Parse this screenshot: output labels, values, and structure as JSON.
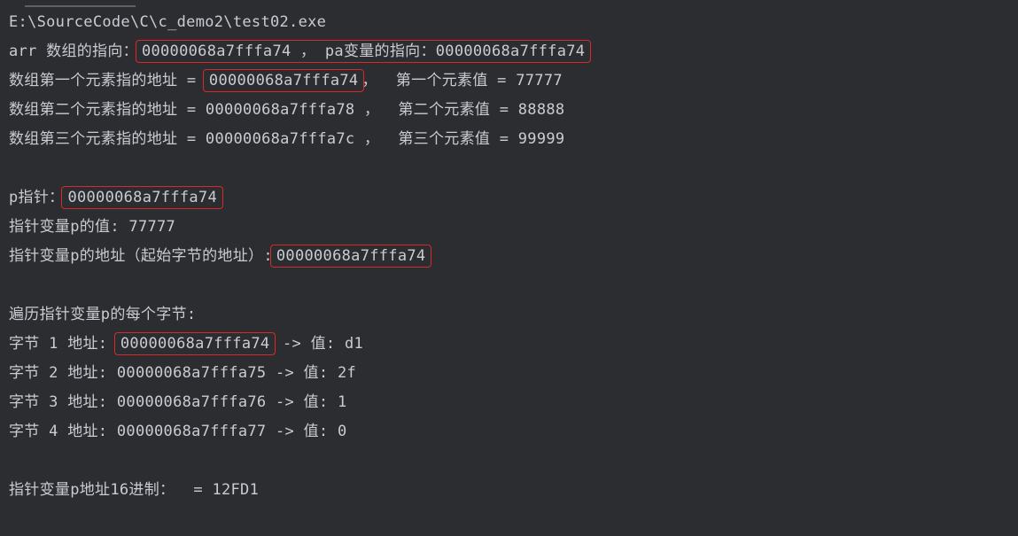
{
  "colors": {
    "background": "#2b2d30",
    "text": "#c9ccd3",
    "highlight_box": "#d8282b"
  },
  "console": {
    "path": "E:\\SourceCode\\C\\c_demo2\\test02.exe",
    "l1_prefix": "arr 数组的指向：",
    "l1_highlight": "00000068a7fffa74 ， pa变量的指向：00000068a7fffa74",
    "l2_prefix": "数组第一个元素指的地址 = ",
    "l2_highlight": "00000068a7fffa74",
    "l2_suffix": "，  第一个元素值 = 77777",
    "l3": "数组第二个元素指的地址 = 00000068a7fffa78 ，  第二个元素值 = 88888",
    "l4": "数组第三个元素指的地址 = 00000068a7fffa7c ，  第三个元素值 = 99999",
    "l5_prefix": "p指针：",
    "l5_highlight": "00000068a7fffa74",
    "l6": "指针变量p的值: 77777",
    "l7_prefix": "指针变量p的地址（起始字节的地址）:",
    "l7_highlight": "00000068a7fffa74",
    "l8": "遍历指针变量p的每个字节:",
    "l9_prefix": "字节 1 地址: ",
    "l9_highlight": "00000068a7fffa74",
    "l9_suffix": " -> 值: d1",
    "l10": "字节 2 地址: 00000068a7fffa75 -> 值: 2f",
    "l11": "字节 3 地址: 00000068a7fffa76 -> 值: 1",
    "l12": "字节 4 地址: 00000068a7fffa77 -> 值: 0",
    "l13": "指针变量p地址16进制：  = 12FD1"
  }
}
